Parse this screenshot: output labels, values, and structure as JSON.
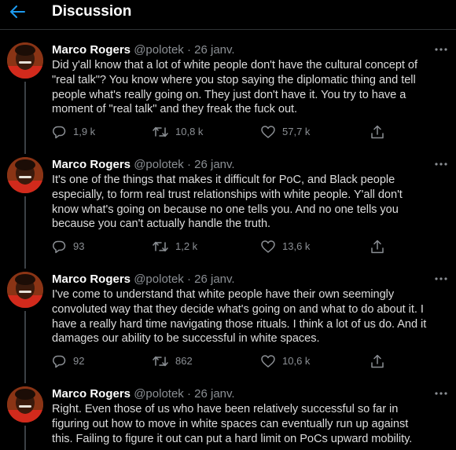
{
  "header": {
    "title": "Discussion",
    "back_icon": "arrow-left-icon",
    "accent_color": "#1d9bf0"
  },
  "tweets": [
    {
      "author_name": "Marco Rogers",
      "handle": "@polotek",
      "separator": "·",
      "date": "26 janv.",
      "text": "Did y'all know that a lot of white people don't have the cultural concept of\n\"real talk\"? You know where you stop saying the diplomatic thing and tell\npeople what's really going on. They just don't have it. You try to have a\nmoment of \"real talk\" and they freak the fuck out.",
      "replies": "1,9 k",
      "retweets": "10,8 k",
      "likes": "57,7 k"
    },
    {
      "author_name": "Marco Rogers",
      "handle": "@polotek",
      "separator": "·",
      "date": "26 janv.",
      "text": "It's one of the things that makes it difficult for PoC, and Black people\nespecially, to form real trust relationships with white people. Y'all don't\nknow what's going on because no one tells you. And no one tells you\nbecause you can't actually handle the truth.",
      "replies": "93",
      "retweets": "1,2 k",
      "likes": "13,6 k"
    },
    {
      "author_name": "Marco Rogers",
      "handle": "@polotek",
      "separator": "·",
      "date": "26 janv.",
      "text": "I've come to understand that white people have their own seemingly\nconvoluted way that they decide what's going on and what to do about it. I\nhave a really hard time navigating those rituals. I think a lot of us do. And it\ndamages our ability to be successful in white spaces.",
      "replies": "92",
      "retweets": "862",
      "likes": "10,6 k"
    },
    {
      "author_name": "Marco Rogers",
      "handle": "@polotek",
      "separator": "·",
      "date": "26 janv.",
      "text": "Right. Even those of us who have been relatively successful so far in\nfiguring out how to move in white spaces can eventually run up against\nthis. Failing to figure it out can put a hard limit on PoCs upward mobility."
    }
  ]
}
